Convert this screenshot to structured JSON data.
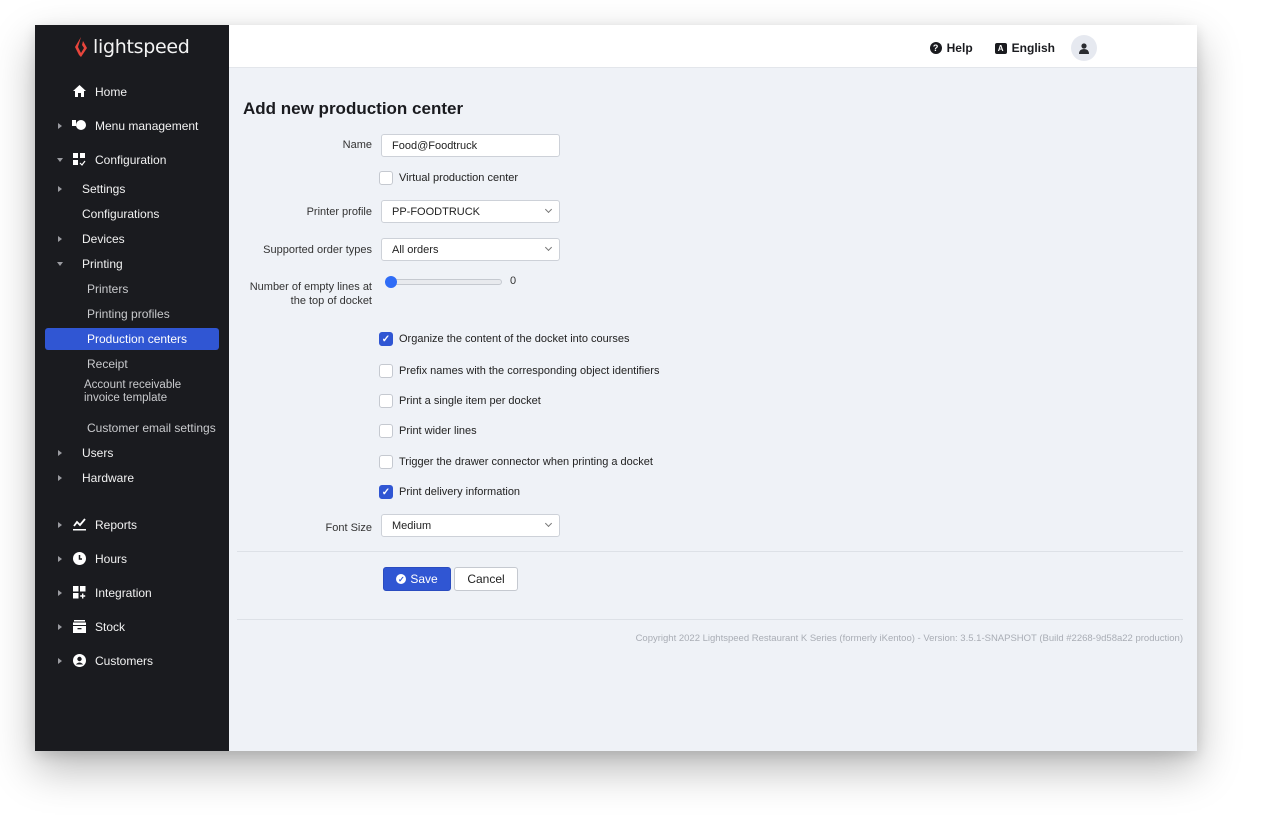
{
  "brand": {
    "name": "lightspeed",
    "accent": "#e8453c"
  },
  "topbar": {
    "help_label": "Help",
    "language_label": "English",
    "help_icon": "question-circle-icon",
    "language_icon": "language-icon",
    "avatar_icon": "user-icon"
  },
  "sidebar": {
    "items": [
      {
        "label": "Home",
        "icon": "home-icon"
      },
      {
        "label": "Menu management",
        "icon": "menu-management-icon"
      },
      {
        "label": "Configuration",
        "icon": "configuration-icon"
      },
      {
        "label": "Settings"
      },
      {
        "label": "Configurations"
      },
      {
        "label": "Devices"
      },
      {
        "label": "Printing"
      },
      {
        "label": "Printers"
      },
      {
        "label": "Printing profiles"
      },
      {
        "label": "Production centers",
        "active": true
      },
      {
        "label": "Receipt"
      },
      {
        "label": "Account receivable invoice template",
        "line1": "Account receivable",
        "line2": "invoice template"
      },
      {
        "label": "Customer email settings"
      },
      {
        "label": "Users"
      },
      {
        "label": "Hardware"
      },
      {
        "label": "Reports",
        "icon": "reports-icon"
      },
      {
        "label": "Hours",
        "icon": "clock-icon"
      },
      {
        "label": "Integration",
        "icon": "integration-icon"
      },
      {
        "label": "Stock",
        "icon": "stock-icon"
      },
      {
        "label": "Customers",
        "icon": "customers-icon"
      }
    ],
    "active_color": "#3056d3"
  },
  "page": {
    "title": "Add new production center",
    "form": {
      "name_label": "Name",
      "name_value": "Food@Foodtruck",
      "virtual_label": "Virtual production center",
      "virtual_checked": false,
      "printer_profile_label": "Printer profile",
      "printer_profile_value": "PP-FOODTRUCK",
      "order_types_label": "Supported order types",
      "order_types_value": "All orders",
      "empty_lines_label_1": "Number of empty lines at",
      "empty_lines_label_2": "the top of docket",
      "empty_lines_value": "0",
      "empty_lines_fraction": 0,
      "options": [
        {
          "label": "Organize the content of the docket into courses",
          "checked": true
        },
        {
          "label": "Prefix names with the corresponding object identifiers",
          "checked": false
        },
        {
          "label": "Print a single item per docket",
          "checked": false
        },
        {
          "label": "Print wider lines",
          "checked": false
        },
        {
          "label": "Trigger the drawer connector when printing a docket",
          "checked": false
        },
        {
          "label": "Print delivery information",
          "checked": true
        }
      ],
      "font_size_label": "Font Size",
      "font_size_value": "Medium",
      "save_label": "Save",
      "cancel_label": "Cancel"
    },
    "footer": "Copyright 2022 Lightspeed Restaurant K Series (formerly iKentoo) - Version: 3.5.1-SNAPSHOT (Build #2268-9d58a22 production)"
  }
}
